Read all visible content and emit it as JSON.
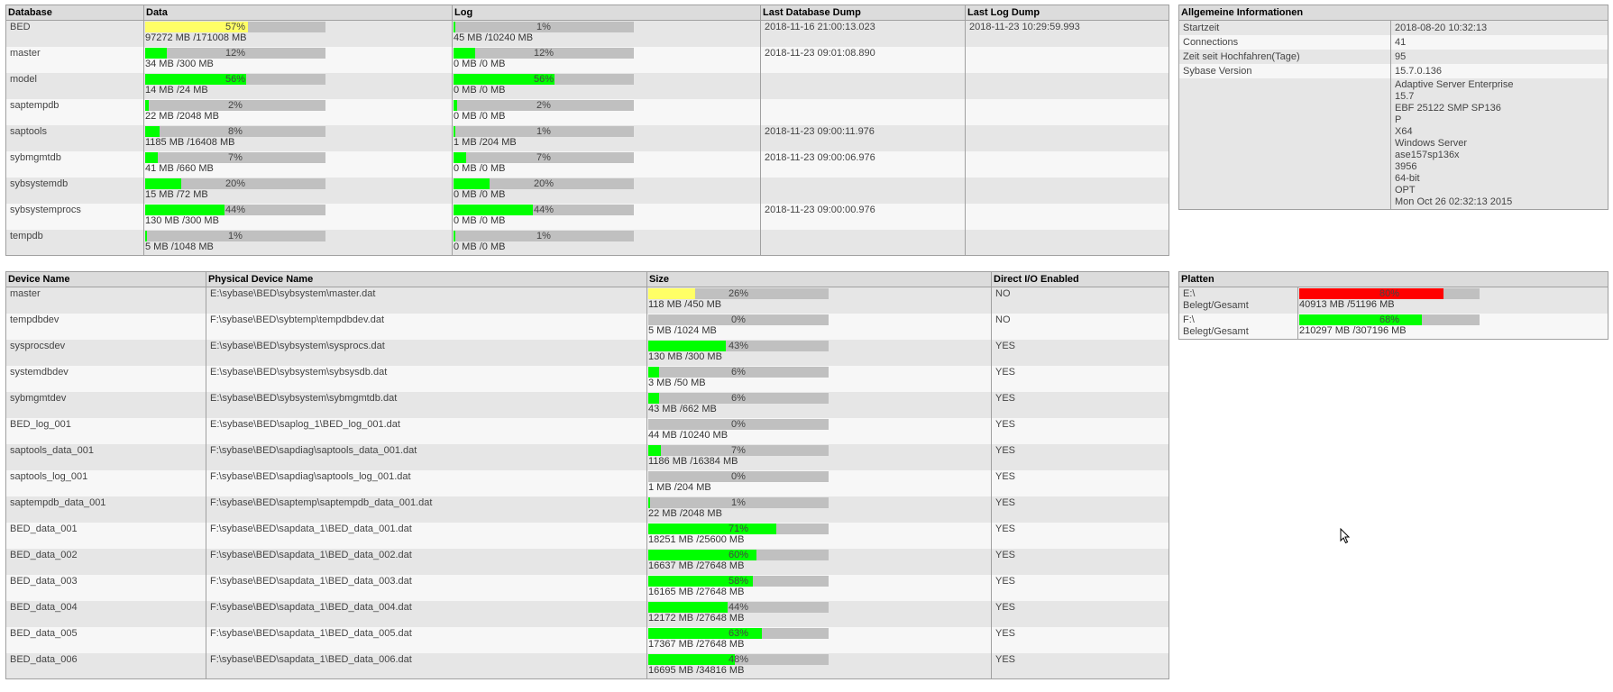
{
  "databases": {
    "headers": [
      "Database",
      "Data",
      "Log",
      "Last Database Dump",
      "Last Log Dump"
    ],
    "rows": [
      {
        "name": "BED",
        "data_pct": "57%",
        "data_level": 57,
        "data_color": "#ffff66",
        "data_text": "97272 MB /171008 MB",
        "log_pct": "1%",
        "log_level": 1,
        "log_color": "#00ff00",
        "log_text": "45 MB /10240 MB",
        "last_db_dump": "2018-11-16 21:00:13.023",
        "last_log_dump": "2018-11-23 10:29:59.993"
      },
      {
        "name": "master",
        "data_pct": "12%",
        "data_level": 12,
        "data_color": "#00ff00",
        "data_text": "34 MB /300 MB",
        "log_pct": "12%",
        "log_level": 12,
        "log_color": "#00ff00",
        "log_text": "0 MB /0 MB",
        "last_db_dump": "2018-11-23 09:01:08.890",
        "last_log_dump": ""
      },
      {
        "name": "model",
        "data_pct": "56%",
        "data_level": 56,
        "data_color": "#00ff00",
        "data_text": "14 MB /24 MB",
        "log_pct": "56%",
        "log_level": 56,
        "log_color": "#00ff00",
        "log_text": "0 MB /0 MB",
        "last_db_dump": "",
        "last_log_dump": ""
      },
      {
        "name": "saptempdb",
        "data_pct": "2%",
        "data_level": 2,
        "data_color": "#00ff00",
        "data_text": "22 MB /2048 MB",
        "log_pct": "2%",
        "log_level": 2,
        "log_color": "#00ff00",
        "log_text": "0 MB /0 MB",
        "last_db_dump": "",
        "last_log_dump": ""
      },
      {
        "name": "saptools",
        "data_pct": "8%",
        "data_level": 8,
        "data_color": "#00ff00",
        "data_text": "1185 MB /16408 MB",
        "log_pct": "1%",
        "log_level": 1,
        "log_color": "#00ff00",
        "log_text": "1 MB /204 MB",
        "last_db_dump": "2018-11-23 09:00:11.976",
        "last_log_dump": ""
      },
      {
        "name": "sybmgmtdb",
        "data_pct": "7%",
        "data_level": 7,
        "data_color": "#00ff00",
        "data_text": "41 MB /660 MB",
        "log_pct": "7%",
        "log_level": 7,
        "log_color": "#00ff00",
        "log_text": "0 MB /0 MB",
        "last_db_dump": "2018-11-23 09:00:06.976",
        "last_log_dump": ""
      },
      {
        "name": "sybsystemdb",
        "data_pct": "20%",
        "data_level": 20,
        "data_color": "#00ff00",
        "data_text": "15 MB /72 MB",
        "log_pct": "20%",
        "log_level": 20,
        "log_color": "#00ff00",
        "log_text": "0 MB /0 MB",
        "last_db_dump": "",
        "last_log_dump": ""
      },
      {
        "name": "sybsystemprocs",
        "data_pct": "44%",
        "data_level": 44,
        "data_color": "#00ff00",
        "data_text": "130 MB /300 MB",
        "log_pct": "44%",
        "log_level": 44,
        "log_color": "#00ff00",
        "log_text": "0 MB /0 MB",
        "last_db_dump": "2018-11-23 09:00:00.976",
        "last_log_dump": ""
      },
      {
        "name": "tempdb",
        "data_pct": "1%",
        "data_level": 1,
        "data_color": "#00ff00",
        "data_text": "5 MB /1048 MB",
        "log_pct": "1%",
        "log_level": 1,
        "log_color": "#00ff00",
        "log_text": "0 MB /0 MB",
        "last_db_dump": "",
        "last_log_dump": ""
      }
    ]
  },
  "info": {
    "header": "Allgemeine Informationen",
    "rows": [
      {
        "label": "Startzeit",
        "value": "2018-08-20 10:32:13"
      },
      {
        "label": "Connections",
        "value": "41"
      },
      {
        "label": "Zeit seit Hochfahren(Tage)",
        "value": "95"
      },
      {
        "label": "Sybase Version",
        "value": "15.7.0.136"
      }
    ],
    "version_detail": [
      "Adaptive Server Enterprise",
      "15.7",
      "EBF 25122 SMP SP136",
      "P",
      "X64",
      "Windows Server",
      "ase157sp136x",
      "3956",
      "64-bit",
      "OPT",
      "Mon Oct 26 02:32:13 2015"
    ]
  },
  "devices": {
    "headers": [
      "Device Name",
      "Physical Device Name",
      "Size",
      "Direct I/O Enabled"
    ],
    "rows": [
      {
        "name": "master",
        "path": "E:\\sybase\\BED\\sybsystem\\master.dat",
        "pct": "26%",
        "level": 26,
        "color": "#ffff66",
        "text": "118 MB /450 MB",
        "dio": "NO"
      },
      {
        "name": "tempdbdev",
        "path": "F:\\sybase\\BED\\sybtemp\\tempdbdev.dat",
        "pct": "0%",
        "level": 0,
        "color": "#00ff00",
        "text": "5 MB /1024 MB",
        "dio": "NO"
      },
      {
        "name": "sysprocsdev",
        "path": "E:\\sybase\\BED\\sybsystem\\sysprocs.dat",
        "pct": "43%",
        "level": 43,
        "color": "#00ff00",
        "text": "130 MB /300 MB",
        "dio": "YES"
      },
      {
        "name": "systemdbdev",
        "path": "E:\\sybase\\BED\\sybsystem\\sybsysdb.dat",
        "pct": "6%",
        "level": 6,
        "color": "#00ff00",
        "text": "3 MB /50 MB",
        "dio": "YES"
      },
      {
        "name": "sybmgmtdev",
        "path": "E:\\sybase\\BED\\sybsystem\\sybmgmtdb.dat",
        "pct": "6%",
        "level": 6,
        "color": "#00ff00",
        "text": "43 MB /662 MB",
        "dio": "YES"
      },
      {
        "name": "BED_log_001",
        "path": "E:\\sybase\\BED\\saplog_1\\BED_log_001.dat",
        "pct": "0%",
        "level": 0,
        "color": "#00ff00",
        "text": "44 MB /10240 MB",
        "dio": "YES"
      },
      {
        "name": "saptools_data_001",
        "path": "F:\\sybase\\BED\\sapdiag\\saptools_data_001.dat",
        "pct": "7%",
        "level": 7,
        "color": "#00ff00",
        "text": "1186 MB /16384 MB",
        "dio": "YES"
      },
      {
        "name": "saptools_log_001",
        "path": "F:\\sybase\\BED\\sapdiag\\saptools_log_001.dat",
        "pct": "0%",
        "level": 0,
        "color": "#00ff00",
        "text": "1 MB /204 MB",
        "dio": "YES"
      },
      {
        "name": "saptempdb_data_001",
        "path": "F:\\sybase\\BED\\saptemp\\saptempdb_data_001.dat",
        "pct": "1%",
        "level": 1,
        "color": "#00ff00",
        "text": "22 MB /2048 MB",
        "dio": "YES"
      },
      {
        "name": "BED_data_001",
        "path": "F:\\sybase\\BED\\sapdata_1\\BED_data_001.dat",
        "pct": "71%",
        "level": 71,
        "color": "#00ff00",
        "text": "18251 MB /25600 MB",
        "dio": "YES"
      },
      {
        "name": "BED_data_002",
        "path": "F:\\sybase\\BED\\sapdata_1\\BED_data_002.dat",
        "pct": "60%",
        "level": 60,
        "color": "#00ff00",
        "text": "16637 MB /27648 MB",
        "dio": "YES"
      },
      {
        "name": "BED_data_003",
        "path": "F:\\sybase\\BED\\sapdata_1\\BED_data_003.dat",
        "pct": "58%",
        "level": 58,
        "color": "#00ff00",
        "text": "16165 MB /27648 MB",
        "dio": "YES"
      },
      {
        "name": "BED_data_004",
        "path": "F:\\sybase\\BED\\sapdata_1\\BED_data_004.dat",
        "pct": "44%",
        "level": 44,
        "color": "#00ff00",
        "text": "12172 MB /27648 MB",
        "dio": "YES"
      },
      {
        "name": "BED_data_005",
        "path": "F:\\sybase\\BED\\sapdata_1\\BED_data_005.dat",
        "pct": "63%",
        "level": 63,
        "color": "#00ff00",
        "text": "17367 MB /27648 MB",
        "dio": "YES"
      },
      {
        "name": "BED_data_006",
        "path": "F:\\sybase\\BED\\sapdata_1\\BED_data_006.dat",
        "pct": "48%",
        "level": 48,
        "color": "#00ff00",
        "text": "16695 MB /34816 MB",
        "dio": "YES"
      }
    ]
  },
  "disks": {
    "header": "Platten",
    "sublabel": "Belegt/Gesamt",
    "rows": [
      {
        "drive": "E:\\",
        "pct": "80%",
        "level": 80,
        "color": "#ff0000",
        "text": "40913 MB /51196 MB"
      },
      {
        "drive": "F:\\",
        "pct": "68%",
        "level": 68,
        "color": "#00ff00",
        "text": "210297 MB /307196 MB"
      }
    ]
  }
}
